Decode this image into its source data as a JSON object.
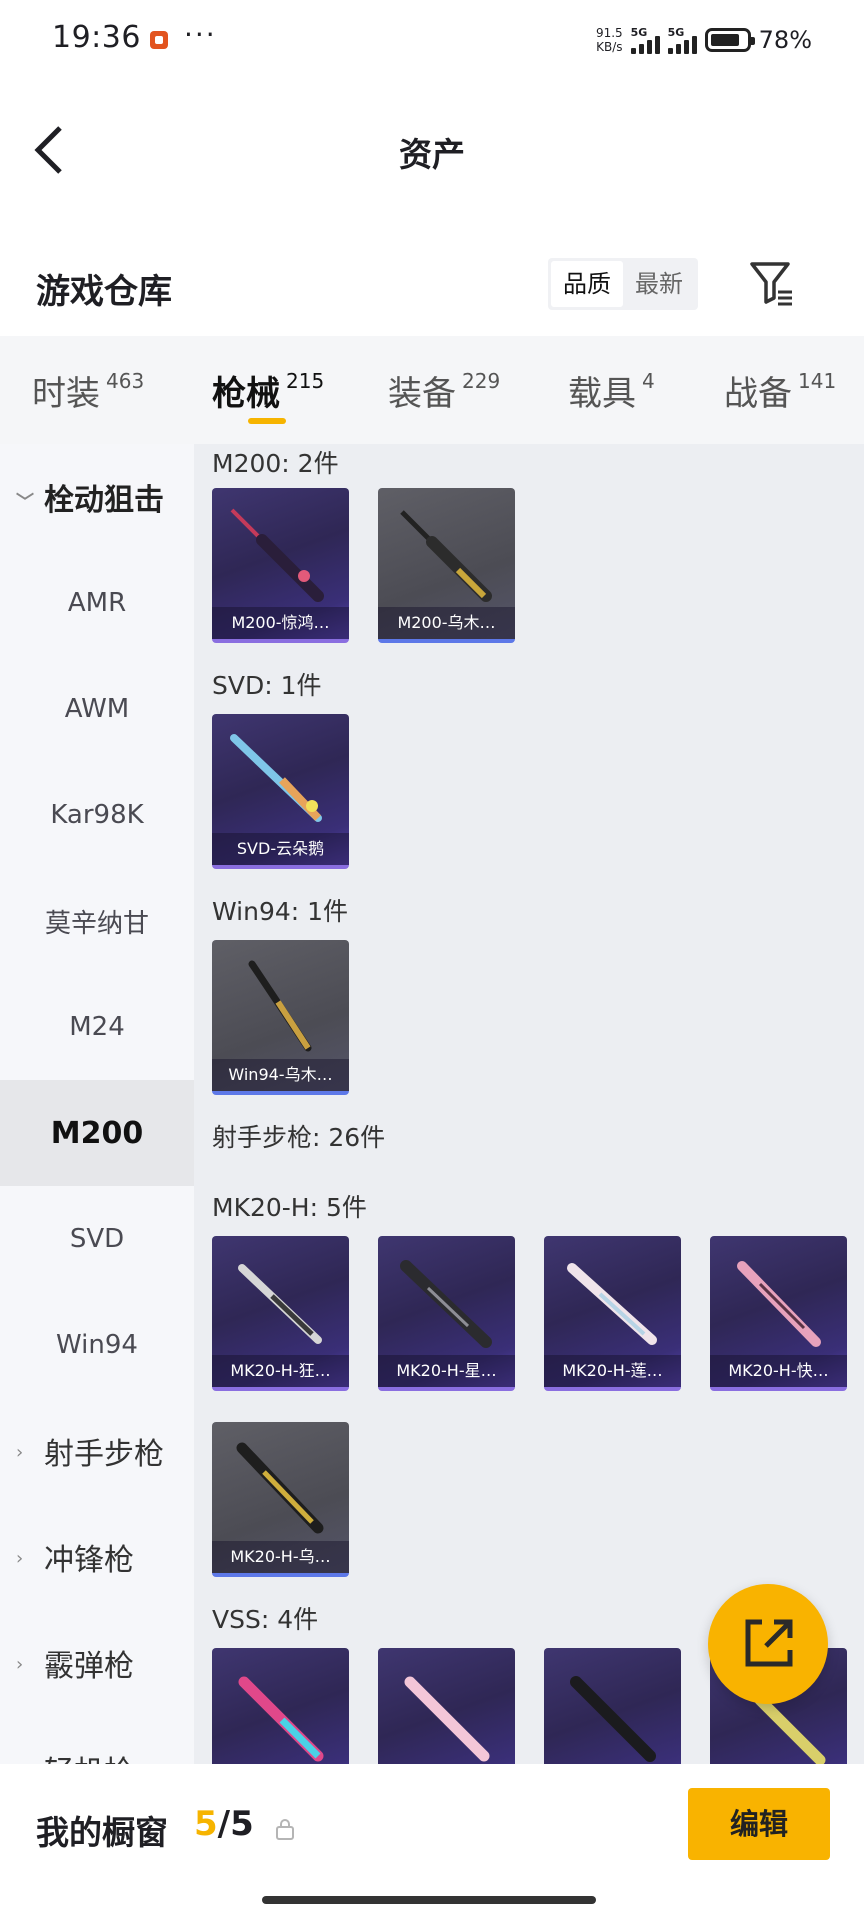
{
  "status_bar": {
    "time": "19:36",
    "dots": "···",
    "speed_top": "91.5",
    "speed_bottom": "KB/s",
    "sim1": "5G",
    "sim2": "5G",
    "battery": "78%"
  },
  "header": {
    "title": "资产",
    "back_icon": "chevron-left-icon"
  },
  "warehouse": {
    "title": "游戏仓库",
    "sort_options": [
      "品质",
      "最新"
    ],
    "selected_sort": "品质",
    "filter_icon": "filter-icon"
  },
  "tabs": [
    {
      "label": "时装",
      "count": "463"
    },
    {
      "label": "枪械",
      "count": "215",
      "active": true
    },
    {
      "label": "装备",
      "count": "229"
    },
    {
      "label": "载具",
      "count": "4"
    },
    {
      "label": "战备",
      "count": "141"
    }
  ],
  "sidebar": {
    "items": [
      {
        "label": "栓动狙击",
        "type": "group",
        "state": "expanded"
      },
      {
        "label": "AMR"
      },
      {
        "label": "AWM"
      },
      {
        "label": "Kar98K"
      },
      {
        "label": "莫辛纳甘"
      },
      {
        "label": "M24"
      },
      {
        "label": "M200",
        "selected": true
      },
      {
        "label": "SVD"
      },
      {
        "label": "Win94"
      },
      {
        "label": "射手步枪",
        "type": "group",
        "state": "collapsed"
      },
      {
        "label": "冲锋枪",
        "type": "group",
        "state": "collapsed"
      },
      {
        "label": "霰弹枪",
        "type": "group",
        "state": "collapsed"
      },
      {
        "label": "轻机枪",
        "type": "group",
        "state": "collapsed"
      }
    ]
  },
  "sections": {
    "m200": {
      "title": "M200: 2件",
      "items": [
        "M200-惊鸿…",
        "M200-乌木…"
      ]
    },
    "svd": {
      "title": "SVD: 1件",
      "items": [
        "SVD-云朵鹅"
      ]
    },
    "win94": {
      "title": "Win94: 1件",
      "items": [
        "Win94-乌木…"
      ]
    },
    "marksman": {
      "title": "射手步枪: 26件"
    },
    "mk20": {
      "title": "MK20-H: 5件",
      "items": [
        "MK20-H-狂…",
        "MK20-H-星…",
        "MK20-H-莲…",
        "MK20-H-快…",
        "MK20-H-乌…"
      ]
    },
    "vss": {
      "title": "VSS: 4件"
    }
  },
  "colors": {
    "accent": "#f9b300",
    "card_purple": "#3a2f78",
    "card_gray": "#55555c",
    "rarity_purple": "#8a6ee0",
    "rarity_blue": "#5d78e8"
  },
  "fab": {
    "icon": "share-external-icon"
  },
  "bottom_bar": {
    "label": "我的橱窗",
    "count_current": "5",
    "count_total": "/5",
    "lock_icon": "lock-icon",
    "edit_label": "编辑"
  }
}
